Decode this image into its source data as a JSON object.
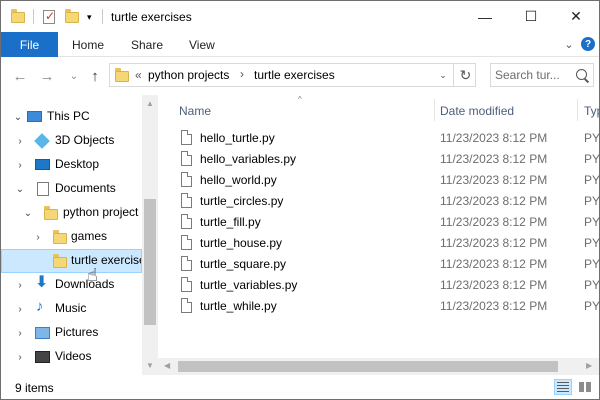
{
  "window": {
    "title": "turtle exercises",
    "minimize": "—",
    "maximize": "☐",
    "close": "✕"
  },
  "ribbon": {
    "tabs": [
      "File",
      "Home",
      "Share",
      "View"
    ],
    "collapse": "⌄"
  },
  "nav": {
    "back": "←",
    "forward": "→",
    "recent": "⌄",
    "up": "↑",
    "overflow": "«",
    "breadcrumb": [
      "python projects",
      "turtle exercises"
    ],
    "separator": "›",
    "refresh": "↻",
    "search_placeholder": "Search tur..."
  },
  "tree": [
    {
      "label": "This PC",
      "icon": "computer-icon",
      "chevron": "⌄"
    },
    {
      "label": "3D Objects",
      "icon": "3d-objects-icon",
      "chevron": "›"
    },
    {
      "label": "Desktop",
      "icon": "desktop-icon",
      "chevron": "›"
    },
    {
      "label": "Documents",
      "icon": "documents-icon",
      "chevron": "⌄"
    },
    {
      "label": "python project",
      "icon": "folder-icon",
      "chevron": "⌄"
    },
    {
      "label": "games",
      "icon": "folder-icon",
      "chevron": "›"
    },
    {
      "label": "turtle exercise",
      "icon": "folder-icon",
      "chevron": ""
    },
    {
      "label": "Downloads",
      "icon": "download-icon",
      "chevron": "›"
    },
    {
      "label": "Music",
      "icon": "music-icon",
      "chevron": "›"
    },
    {
      "label": "Pictures",
      "icon": "pictures-icon",
      "chevron": "›"
    },
    {
      "label": "Videos",
      "icon": "videos-icon",
      "chevron": "›"
    }
  ],
  "columns": {
    "name": "Name",
    "date": "Date modified",
    "type": "Typ",
    "sort_arrow": "^"
  },
  "files": [
    {
      "name": "hello_turtle.py",
      "date": "11/23/2023 8:12 PM",
      "type": "PY"
    },
    {
      "name": "hello_variables.py",
      "date": "11/23/2023 8:12 PM",
      "type": "PY"
    },
    {
      "name": "hello_world.py",
      "date": "11/23/2023 8:12 PM",
      "type": "PY"
    },
    {
      "name": "turtle_circles.py",
      "date": "11/23/2023 8:12 PM",
      "type": "PY"
    },
    {
      "name": "turtle_fill.py",
      "date": "11/23/2023 8:12 PM",
      "type": "PY"
    },
    {
      "name": "turtle_house.py",
      "date": "11/23/2023 8:12 PM",
      "type": "PY"
    },
    {
      "name": "turtle_square.py",
      "date": "11/23/2023 8:12 PM",
      "type": "PY"
    },
    {
      "name": "turtle_variables.py",
      "date": "11/23/2023 8:12 PM",
      "type": "PY"
    },
    {
      "name": "turtle_while.py",
      "date": "11/23/2023 8:12 PM",
      "type": "PY"
    }
  ],
  "status": {
    "count": "9 items"
  },
  "colors": {
    "accent": "#1a6fc9",
    "selection": "#cce8ff",
    "selection_border": "#99d1ff",
    "header_text": "#4c607a"
  }
}
